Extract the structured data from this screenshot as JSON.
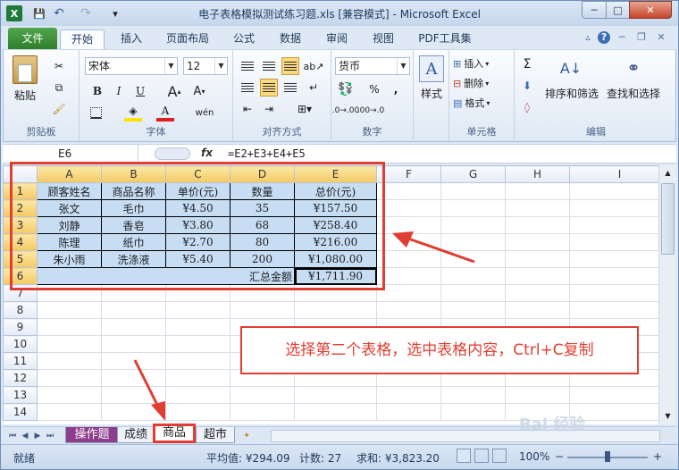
{
  "window": {
    "title": "电子表格模拟测试练习题.xls  [兼容模式] - Microsoft Excel",
    "min_label": "─",
    "max_label": "□",
    "close_label": "✕"
  },
  "qat": {
    "logo": "X",
    "save_icon": "💾",
    "undo_icon": "↶",
    "redo_icon": "↷",
    "more_icon": "▾"
  },
  "ribbon_tabs": [
    "文件",
    "开始",
    "插入",
    "页面布局",
    "公式",
    "数据",
    "审阅",
    "视图",
    "PDF工具集"
  ],
  "ribbon": {
    "clipboard": {
      "paste": "粘贴",
      "label": "剪贴板"
    },
    "font": {
      "name": "宋体",
      "size": "12",
      "bold": "B",
      "italic": "I",
      "underline": "U",
      "font_color": "A",
      "label": "字体"
    },
    "alignment": {
      "label": "对齐方式"
    },
    "number": {
      "format": "货币",
      "percent": "%",
      "comma": ",",
      "label": "数字"
    },
    "styles": {
      "label": "样式"
    },
    "cells": {
      "insert": "插入",
      "delete": "删除",
      "format": "格式",
      "label": "单元格"
    },
    "editing": {
      "sum": "Σ",
      "sort_filter": "排序和筛选",
      "find_select": "查找和选择",
      "label": "编辑"
    }
  },
  "formula_bar": {
    "name_box": "E6",
    "fx": "fx",
    "formula": "=E2+E3+E4+E5"
  },
  "sheet": {
    "columns": [
      "A",
      "B",
      "C",
      "D",
      "E",
      "F",
      "G",
      "H",
      "I"
    ],
    "rows": [
      "1",
      "2",
      "3",
      "4",
      "5",
      "6",
      "7",
      "8",
      "9",
      "10",
      "11",
      "12",
      "13",
      "14"
    ],
    "header": [
      "顾客姓名",
      "商品名称",
      "单价(元)",
      "数量",
      "总价(元)"
    ],
    "data": [
      [
        "张文",
        "毛巾",
        "¥4.50",
        "35",
        "¥157.50"
      ],
      [
        "刘静",
        "香皂",
        "¥3.80",
        "68",
        "¥258.40"
      ],
      [
        "陈理",
        "纸巾",
        "¥2.70",
        "80",
        "¥216.00"
      ],
      [
        "朱小雨",
        "洗涤液",
        "¥5.40",
        "200",
        "¥1,080.00"
      ]
    ],
    "total_label": "汇总金额",
    "total_value": "¥1,711.90"
  },
  "sheet_tabs": [
    "操作题",
    "成绩",
    "商品",
    "超市"
  ],
  "status": {
    "mode": "就绪",
    "average": "平均值: ¥294.09",
    "count": "计数: 27",
    "sum": "求和: ¥3,823.20",
    "zoom": "100%",
    "zoom_minus": "−",
    "zoom_plus": "+"
  },
  "annotation": {
    "text": "选择第二个表格，选中表格内容，Ctrl+C复制"
  },
  "watermark": "Bai 经验",
  "colors": {
    "accent": "#e03e33",
    "selection": "#c7ddf4",
    "file_tab": "#2f7f2b"
  }
}
